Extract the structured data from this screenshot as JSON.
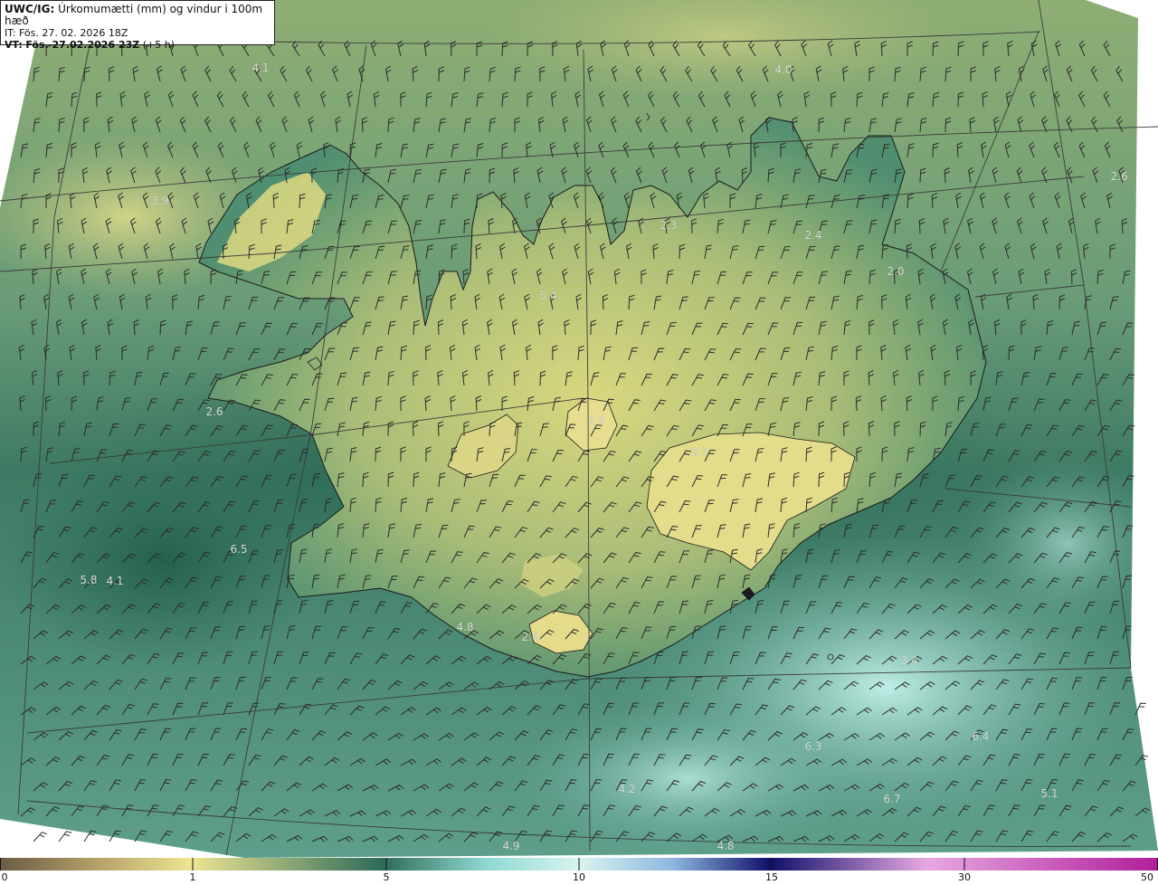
{
  "header": {
    "product_label": "UWC/IG:",
    "title": "Úrkomumætti (mm) og vindur i 100m hæð",
    "init_time": "IT: Fös. 27. 02. 2026 18Z",
    "valid_prefix": "VT:",
    "valid_time": "Fös. 27.02.2026 23Z",
    "lead_time": "(+5 h)"
  },
  "colorbar": {
    "ticks": [
      "0",
      "1",
      "5",
      "10",
      "15",
      "30",
      "50"
    ],
    "tick_values": [
      0,
      1,
      5,
      10,
      15,
      30,
      50
    ],
    "colors": [
      "#6b5a45",
      "#b9a66a",
      "#efe593",
      "#2d6b58",
      "#8fd9d3",
      "#d9f3f0",
      "#2b2b86",
      "#10106a",
      "#f0a6e0",
      "#b01e9a"
    ]
  },
  "map": {
    "colors": {
      "land_yellow": "#d7d67f",
      "sea_green": "#2f6c58",
      "sea_mid": "#4b8f74",
      "teal_light": "#93cfc4",
      "coast": "#1a1a1a",
      "wind_barb": "#2b2b2b",
      "grid": "#3b3b3b"
    },
    "labels": [
      {
        "id": "label-nw-sea",
        "text": "4.1"
      },
      {
        "id": "label-north-sea",
        "text": "4.0"
      },
      {
        "id": "label-west-sea",
        "text": "3.9"
      },
      {
        "id": "label-ne-sea",
        "text": "2.6"
      },
      {
        "id": "label-north-1",
        "text": "2.3"
      },
      {
        "id": "label-north-2",
        "text": "2.4"
      },
      {
        "id": "label-east",
        "text": "2.0"
      },
      {
        "id": "label-north-central",
        "text": "5.4"
      },
      {
        "id": "label-snaefells",
        "text": "2.6"
      },
      {
        "id": "label-interior-1",
        "text": "2.4"
      },
      {
        "id": "label-vatnajokull",
        "text": "3.3"
      },
      {
        "id": "label-sw-sea-1",
        "text": "6.5"
      },
      {
        "id": "label-sw-sea-2",
        "text": "5.8"
      },
      {
        "id": "label-sw-sea-3",
        "text": "4.1"
      },
      {
        "id": "label-south-1",
        "text": "4.8"
      },
      {
        "id": "label-south-2",
        "text": "2.6"
      },
      {
        "id": "label-se-sea-1",
        "text": "3.4"
      },
      {
        "id": "label-se-sea-2",
        "text": "6.3"
      },
      {
        "id": "label-se-sea-3",
        "text": "6.4"
      },
      {
        "id": "label-se-sea-4",
        "text": "6.7"
      },
      {
        "id": "label-s-sea-1",
        "text": "4.2"
      },
      {
        "id": "label-s-sea-2",
        "text": "4.8"
      },
      {
        "id": "label-s-sea-3",
        "text": "4.9"
      },
      {
        "id": "label-e-sea",
        "text": "5.1"
      }
    ]
  }
}
